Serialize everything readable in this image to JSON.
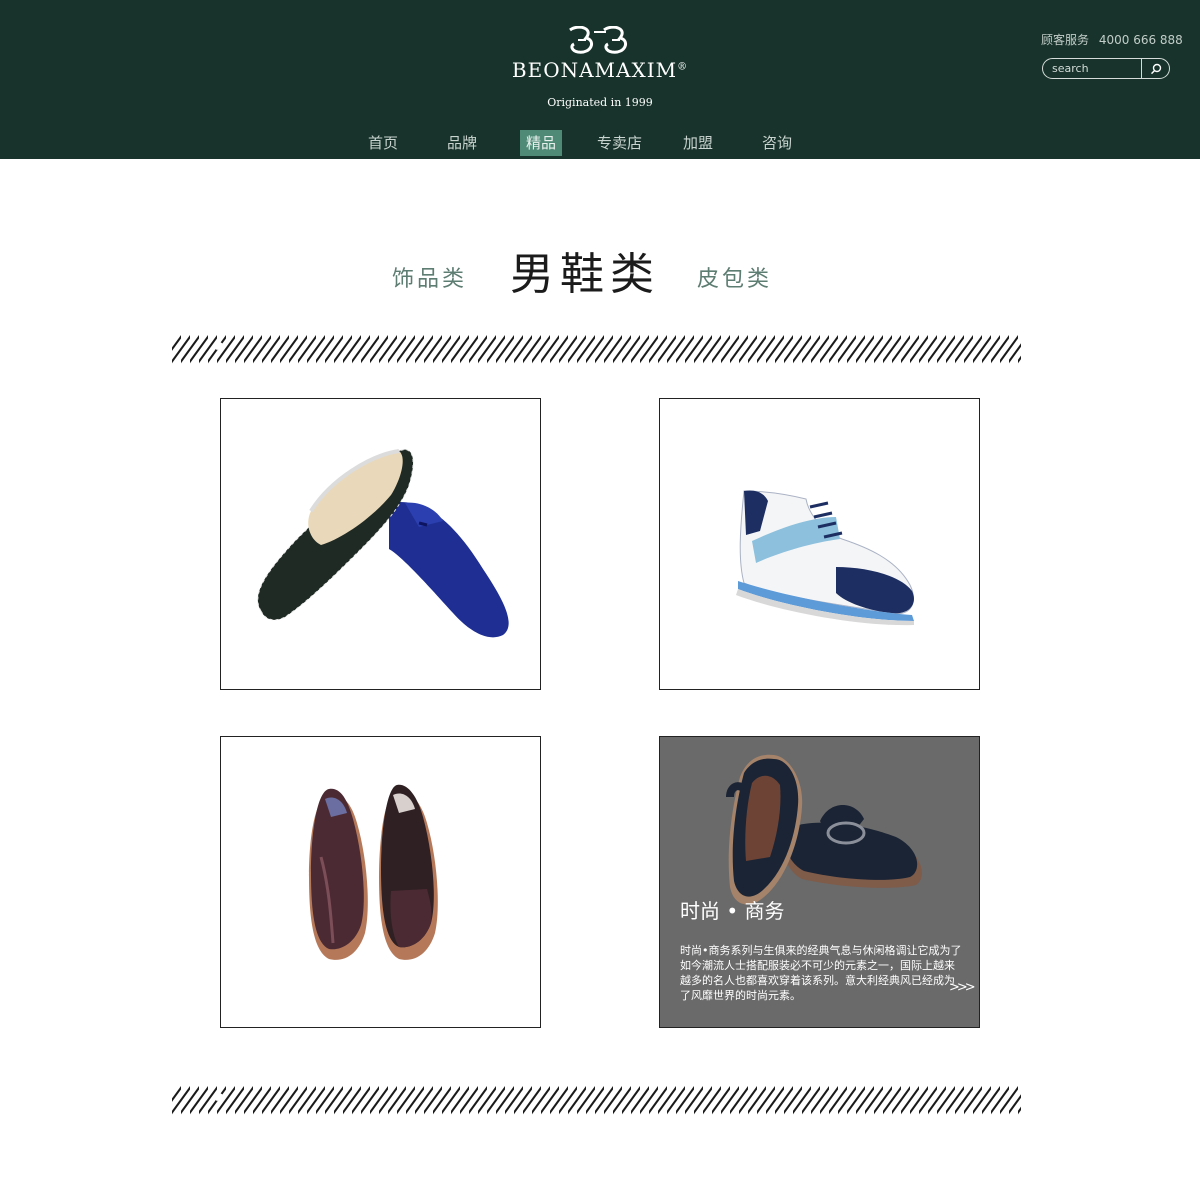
{
  "header": {
    "brand_name": "BEONAMAXIM",
    "brand_mark": "®",
    "tagline": "Originated in 1999",
    "hotline_label": "顾客服务",
    "hotline_number": "4000 666 888",
    "search_placeholder": "search",
    "logo_icon": "bb-monogram-logo",
    "search_icon": "magnifier-icon",
    "colors": {
      "background": "#17332b",
      "active_nav": "#4f8a76"
    }
  },
  "nav": {
    "items": [
      {
        "label": "首页"
      },
      {
        "label": "品牌"
      },
      {
        "label": "精品",
        "active": true
      },
      {
        "label": "专卖店"
      },
      {
        "label": "加盟"
      },
      {
        "label": "咨询"
      }
    ]
  },
  "categories": {
    "left": "饰品类",
    "current": "男鞋类",
    "right": "皮包类"
  },
  "products": [
    {
      "image": "woven-loafer-and-blue-suede-loafer"
    },
    {
      "image": "white-blue-sneaker"
    },
    {
      "image": "brown-oxford-pair"
    },
    {
      "image": "navy-horsebit-loafers",
      "hover": true,
      "title": "时尚 • 商务",
      "description": "时尚•商务系列与生俱来的经典气息与休闲格调让它成为了如今潮流人士搭配服装必不可少的元素之一，国际上越来越多的名人也都喜欢穿着该系列。意大利经典风已经成为了风靡世界的时尚元素。",
      "more": ">>>"
    }
  ]
}
